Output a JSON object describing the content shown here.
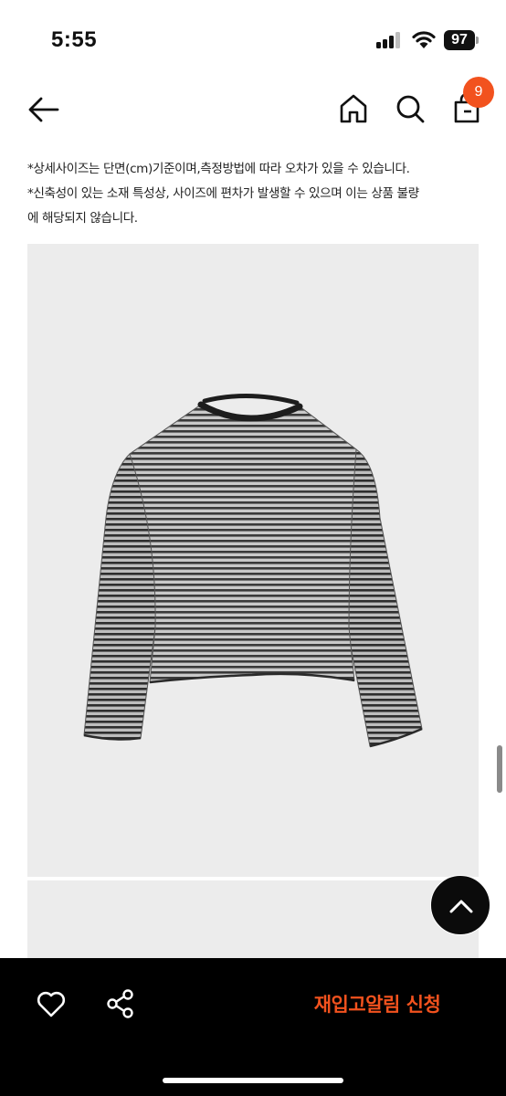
{
  "status_bar": {
    "time": "5:55",
    "battery": "97",
    "icons": [
      "signal-icon",
      "wifi-icon",
      "battery-icon"
    ]
  },
  "header": {
    "icons": [
      "back-arrow-icon",
      "home-icon",
      "search-icon",
      "cart-icon"
    ],
    "cart_badge": "9"
  },
  "notice": {
    "line1": "*상세사이즈는 단면(cm)기준이며,측정방법에 따라 오차가 있을 수 있습니다.",
    "line2": "*신축성이 있는 소재 특성상, 사이즈에 편차가 발생할 수 있으며 이는 상품 불량",
    "line3": "에 해당되지 않습니다."
  },
  "bottom_bar": {
    "icons": [
      "heart-icon",
      "share-icon"
    ],
    "restock_label": "재입고알림 신청"
  },
  "colors": {
    "accent": "#f2521e",
    "image_background": "#ececec",
    "bottom_bar": "#000000"
  }
}
